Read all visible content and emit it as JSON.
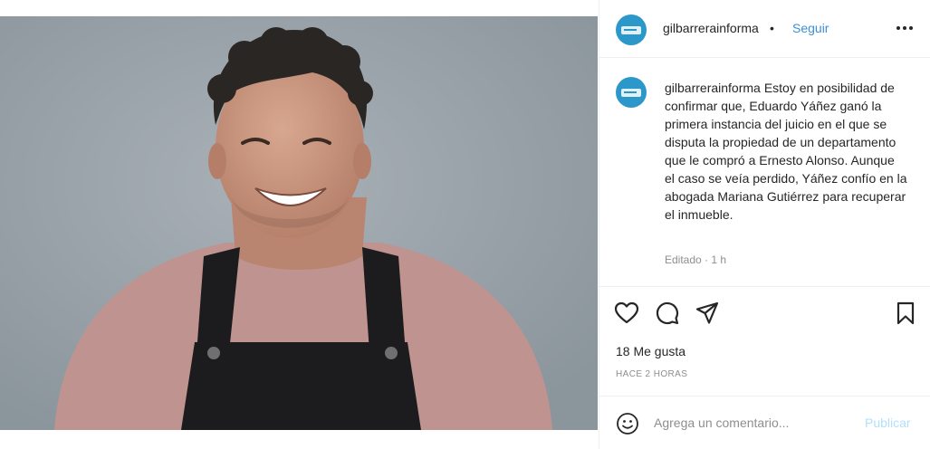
{
  "post": {
    "username": "gilbarrerainforma",
    "separator": "•",
    "follow_label": "Seguir",
    "caption_user": "gilbarrerainforma",
    "caption_text": "Estoy en posibilidad de confirmar que, Eduardo Yáñez ganó la primera instancia del juicio en el que se disputa la propiedad de un departamento que le compró a Ernesto Alonso. Aunque el caso se veía perdido, Yáñez confío en la abogada Mariana Gutiérrez para recuperar el inmueble.",
    "edited_label": "Editado · 1 h",
    "likes_label": "18 Me gusta",
    "timestamp_label": "HACE 2 HORAS"
  },
  "comment": {
    "placeholder": "Agrega un comentario...",
    "publish_label": "Publicar"
  },
  "icons": {
    "more": "more-options-icon",
    "like": "heart-icon",
    "comment": "comment-bubble-icon",
    "share": "paper-plane-icon",
    "save": "bookmark-icon",
    "emoji": "emoji-smiley-icon"
  },
  "colors": {
    "accent": "#3c8fd6",
    "avatar_bg": "#2c97c9",
    "muted": "#8e8e8e",
    "publish_disabled": "#b2dffc"
  }
}
